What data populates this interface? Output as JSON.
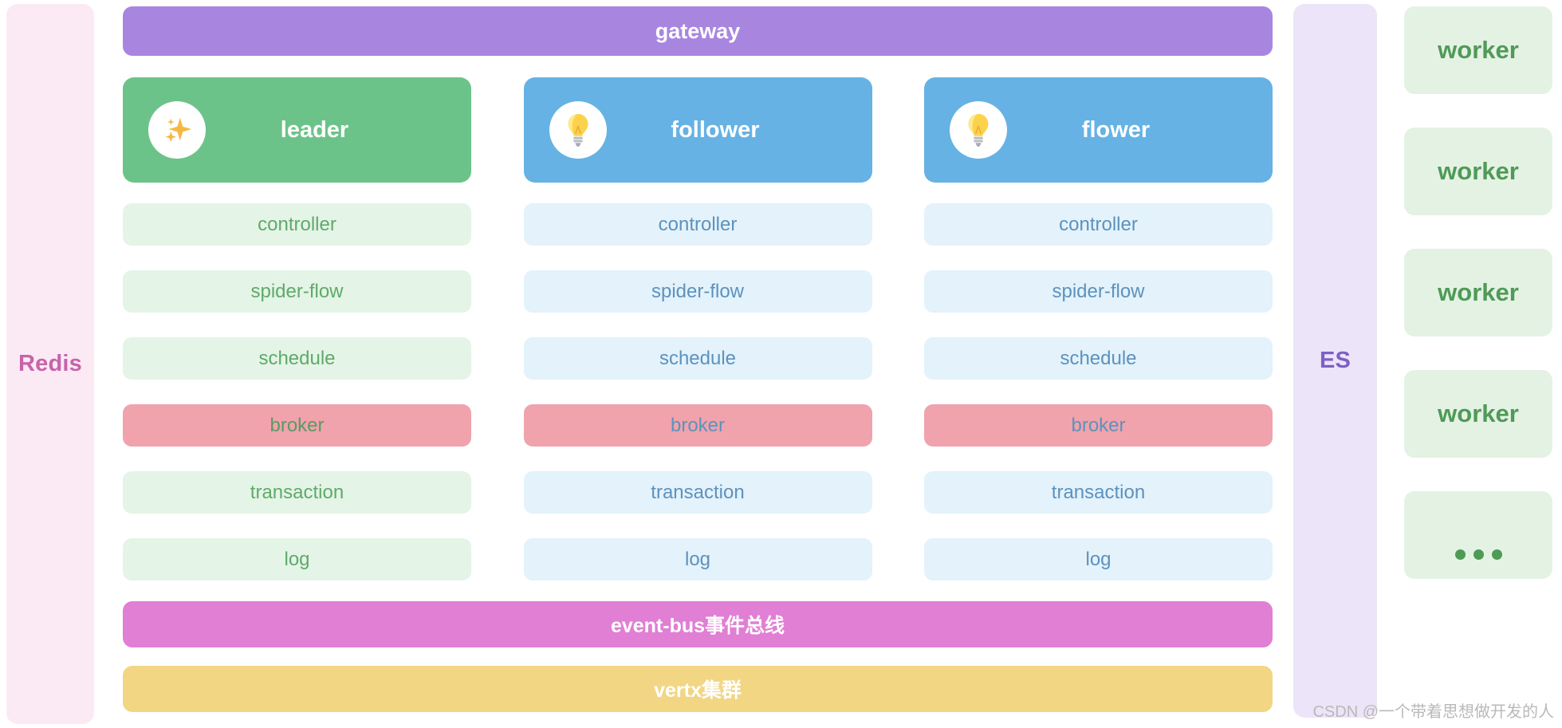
{
  "sides": {
    "redis": {
      "label": "Redis",
      "color": "#c763ab",
      "bg": "#fbeaf4"
    },
    "es": {
      "label": "ES",
      "color": "#7d5fc4",
      "bg": "#ece4f8"
    }
  },
  "bars": {
    "gateway": {
      "label": "gateway",
      "color": "#a886e0"
    },
    "event_bus": {
      "label": "event-bus事件总线",
      "color": "#e07fd4"
    },
    "vertx": {
      "label": "vertx集群",
      "color": "#f2d684"
    }
  },
  "columns": [
    {
      "name": "leader",
      "title": "leader",
      "icon": "sparkle-icon",
      "header_color": "#6cc389",
      "rows": [
        {
          "label": "controller",
          "variant": "green"
        },
        {
          "label": "spider-flow",
          "variant": "green"
        },
        {
          "label": "schedule",
          "variant": "green"
        },
        {
          "label": "broker",
          "variant": "broker-green"
        },
        {
          "label": "transaction",
          "variant": "green"
        },
        {
          "label": "log",
          "variant": "green"
        }
      ]
    },
    {
      "name": "follower",
      "title": "follower",
      "icon": "lightbulb-icon",
      "header_color": "#66b2e4",
      "rows": [
        {
          "label": "controller",
          "variant": "blue"
        },
        {
          "label": "spider-flow",
          "variant": "blue"
        },
        {
          "label": "schedule",
          "variant": "blue"
        },
        {
          "label": "broker",
          "variant": "broker-blue"
        },
        {
          "label": "transaction",
          "variant": "blue"
        },
        {
          "label": "log",
          "variant": "blue"
        }
      ]
    },
    {
      "name": "flower",
      "title": "flower",
      "icon": "lightbulb-icon",
      "header_color": "#66b2e4",
      "rows": [
        {
          "label": "controller",
          "variant": "blue"
        },
        {
          "label": "spider-flow",
          "variant": "blue"
        },
        {
          "label": "schedule",
          "variant": "blue"
        },
        {
          "label": "broker",
          "variant": "broker-blue"
        },
        {
          "label": "transaction",
          "variant": "blue"
        },
        {
          "label": "log",
          "variant": "blue"
        }
      ]
    }
  ],
  "workers": [
    {
      "label": "worker",
      "type": "text"
    },
    {
      "label": "worker",
      "type": "text"
    },
    {
      "label": "worker",
      "type": "text"
    },
    {
      "label": "worker",
      "type": "text"
    },
    {
      "label": "",
      "type": "ellipsis"
    }
  ],
  "watermark": {
    "text": "CSDN @一个带着思想做开发的人"
  }
}
